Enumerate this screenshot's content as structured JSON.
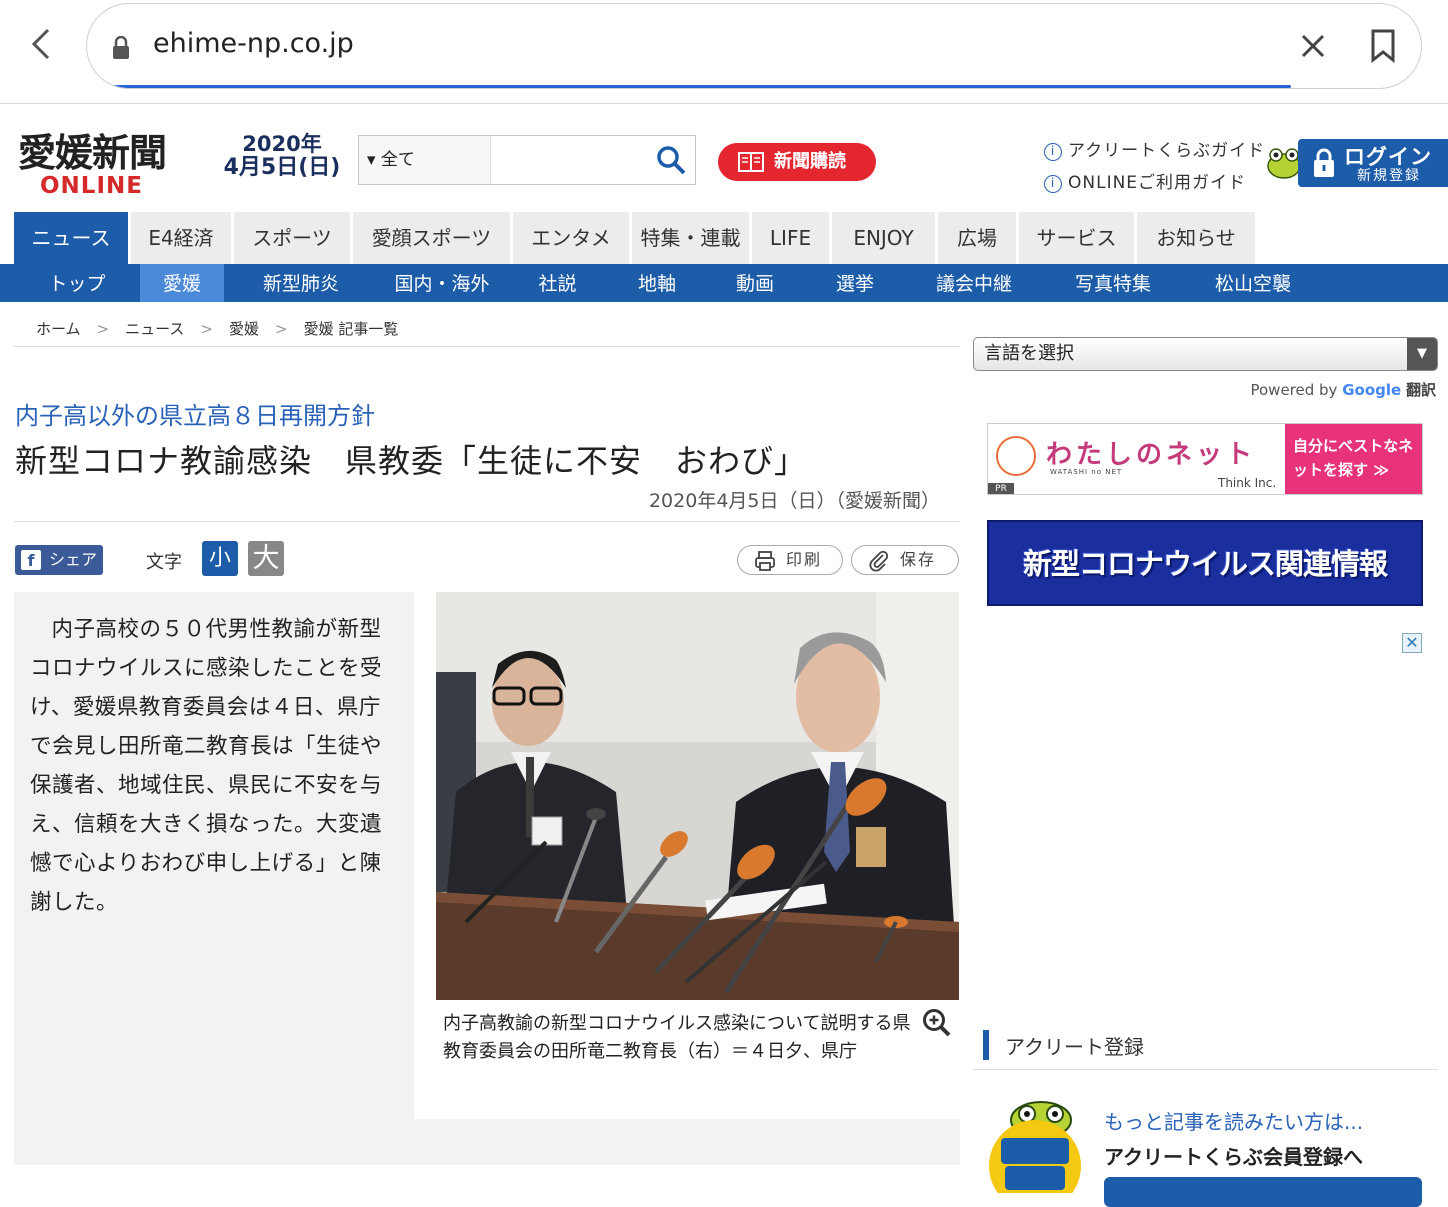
{
  "browser": {
    "url": "ehime-np.co.jp"
  },
  "header": {
    "logo_main": "愛媛新聞",
    "logo_sub": "ONLINE",
    "date_year": "2020年",
    "date_day": "4月5日(日)",
    "search_scope": "▾ 全て",
    "search_placeholder": "",
    "subscribe_label": "新聞購読",
    "guide1": "アクリートくらぶガイド",
    "guide2": "ONLINEご利用ガイド",
    "login_label": "ログイン",
    "register_label": "新規登録"
  },
  "nav": {
    "main": [
      {
        "label": "ニュース"
      },
      {
        "label": "E4経済"
      },
      {
        "label": "スポーツ"
      },
      {
        "label": "愛顔スポーツ"
      },
      {
        "label": "エンタメ"
      },
      {
        "label": "特集・連載"
      },
      {
        "label": "LIFE"
      },
      {
        "label": "ENJOY"
      },
      {
        "label": "広場"
      },
      {
        "label": "サービス"
      },
      {
        "label": "お知らせ"
      }
    ],
    "sub": [
      {
        "label": "トップ"
      },
      {
        "label": "愛媛"
      },
      {
        "label": "新型肺炎"
      },
      {
        "label": "国内・海外"
      },
      {
        "label": "社説"
      },
      {
        "label": "地軸"
      },
      {
        "label": "動画"
      },
      {
        "label": "選挙"
      },
      {
        "label": "議会中継"
      },
      {
        "label": "写真特集"
      },
      {
        "label": "松山空襲"
      }
    ]
  },
  "breadcrumb": [
    "ホーム",
    "ニュース",
    "愛媛",
    "愛媛 記事一覧"
  ],
  "breadcrumb_sep": ">",
  "article": {
    "subtitle": "内子高以外の県立高８日再開方針",
    "headline": "新型コロナ教諭感染　県教委「生徒に不安　おわび」",
    "date": "2020年4月5日（日）（愛媛新聞）",
    "share_label": "シェア",
    "font_label": "文字",
    "font_small": "小",
    "font_large": "大",
    "print_label": "印刷",
    "save_label": "保存",
    "body": "内子高校の５０代男性教諭が新型コロナウイルスに感染したことを受け、愛媛県教育委員会は４日、県庁で会見し田所竜二教育長は「生徒や保護者、地域住民、県民に不安を与え、信頼を大きく損なった。大変遺憾で心よりおわび申し上げる」と陳謝した。",
    "caption": "内子高教諭の新型コロナウイルス感染について説明する県教育委員会の田所竜二教育長（右）＝４日夕、県庁"
  },
  "sidebar": {
    "language_select": "言語を選択",
    "powered_by": "Powered by",
    "google": "Google",
    "translate": "翻訳",
    "ad1_brand": "わたしのネット",
    "ad1_brand_sub": "WATASHI no NET",
    "ad1_company": "Think Inc.",
    "ad1_pr": "PR",
    "ad1_cta": "自分にベストなネットを探す ≫",
    "ad2_text": "新型コロナウイルス関連情報",
    "agr_heading": "アクリート登録",
    "agr_question": "もっと記事を読みたい方は...",
    "agr_answer": "アクリートくらぶ会員登録へ"
  },
  "colors": {
    "brand_blue": "#1d5ca8",
    "accent_red": "#e4262e",
    "link_blue": "#2a62b8"
  }
}
